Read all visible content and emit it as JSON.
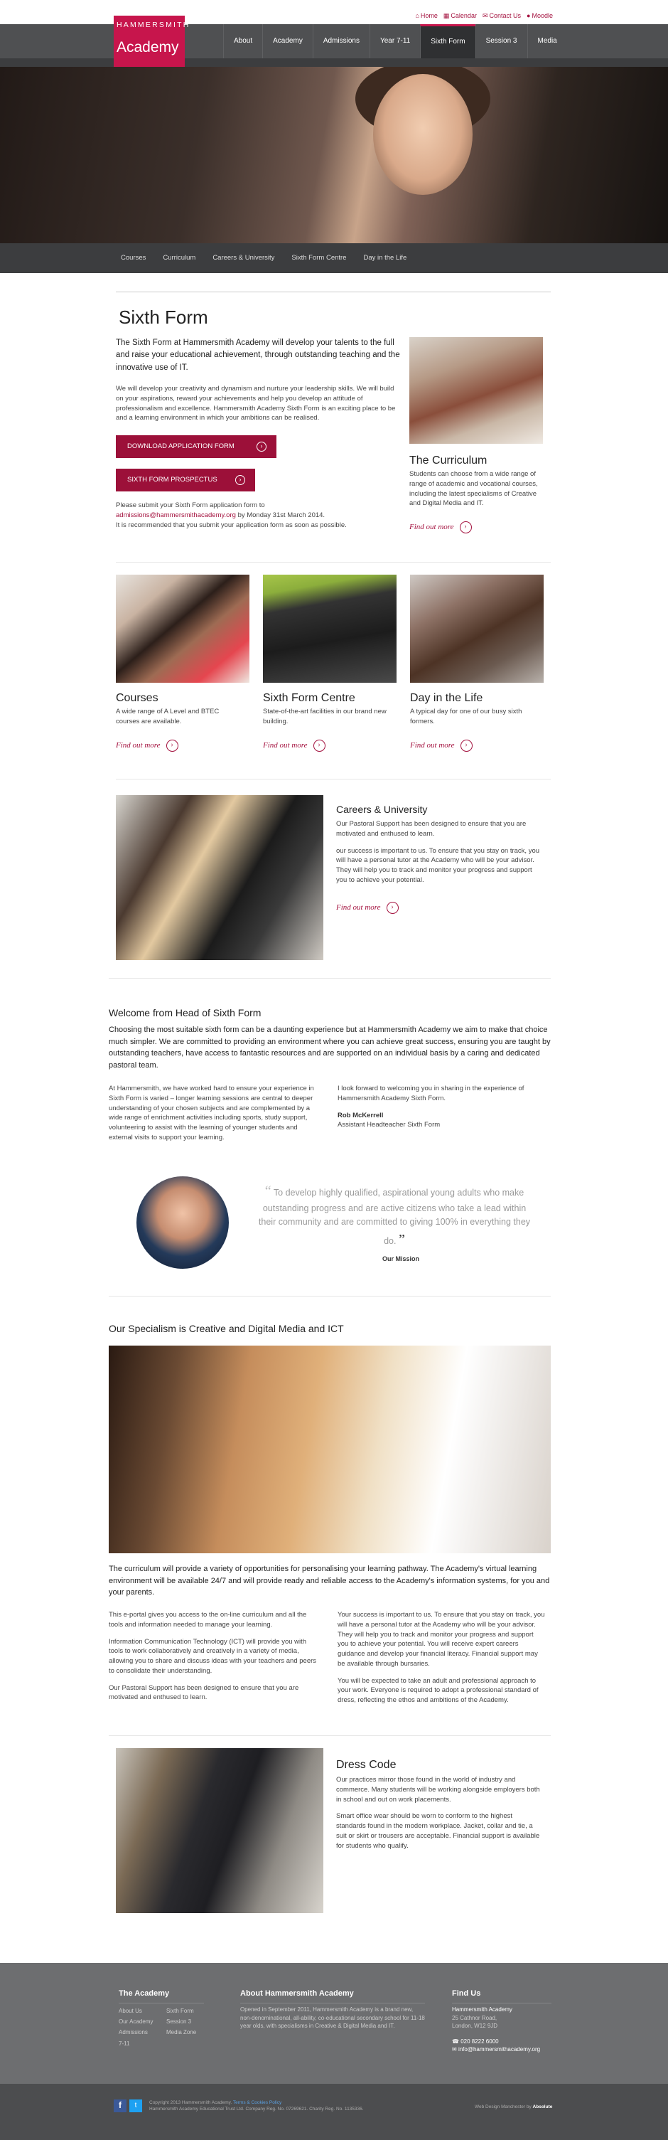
{
  "util_links": [
    {
      "icon": "home-icon",
      "label": "Home"
    },
    {
      "icon": "calendar-icon",
      "label": "Calendar"
    },
    {
      "icon": "mail-icon",
      "label": "Contact Us"
    },
    {
      "icon": "moodle-icon",
      "label": "Moodle"
    }
  ],
  "logo": {
    "line1": "HAMMERSMITH",
    "line2": "Academy"
  },
  "nav": [
    "About",
    "Academy",
    "Admissions",
    "Year 7-11",
    "Sixth Form",
    "Session 3",
    "Media"
  ],
  "subnav": [
    "Courses",
    "Curriculum",
    "Careers & University",
    "Sixth Form Centre",
    "Day in the Life"
  ],
  "intro": {
    "title": "Sixth Form",
    "lead": "The Sixth Form at Hammersmith Academy will develop your talents to the full and raise your educational achievement, through outstanding teaching and the innovative use of IT.",
    "body": "We will develop your creativity and dynamism and nurture your leadership skills. We will build on your aspirations, reward your achievements and help you develop an attitude of professionalism and excellence. Hammersmith Academy Sixth Form is an exciting place to be and a learning environment in which your ambitions can be realised.",
    "btn1": "DOWNLOAD APPLICATION FORM",
    "btn2": "SIXTH FORM PROSPECTUS",
    "submit1": "Please submit your Sixth Form application form to",
    "email": "admissions@hammersmithacademy.org",
    "submit2": "by Monday 31st March 2014.",
    "submit3": "It is recommended that you submit your application form as soon as possible."
  },
  "curriculum": {
    "title": "The Curriculum",
    "text": "Students can choose from a wide range of range of academic and vocational courses, including the latest specialisms of Creative and Digital Media and IT.",
    "link": "Find out more"
  },
  "cards": [
    {
      "title": "Courses",
      "text": "A wide range of A Level and BTEC courses are available.",
      "link": "Find out more"
    },
    {
      "title": "Sixth Form Centre",
      "text": "State-of-the-art facilities in our brand new building.",
      "link": "Find out more"
    },
    {
      "title": "Day in the Life",
      "text": "A typical day for one of our busy sixth formers.",
      "link": "Find out more"
    }
  ],
  "careers": {
    "title": "Careers & University",
    "p1": "Our Pastoral Support has been designed to ensure that you are motivated and enthused to learn.",
    "p2": "our success is important to us. To ensure that you stay on track, you will have a personal tutor at the Academy who will be your advisor. They will help you to track and monitor your progress and support you to achieve your potential.",
    "link": "Find out more"
  },
  "welcome": {
    "title": "Welcome from Head of Sixth Form",
    "lead": "Choosing the most suitable sixth form can be a daunting experience but at Hammersmith Academy we aim to make that choice much simpler. We are committed to providing an environment where you can achieve great success, ensuring you are taught by outstanding teachers, have access to fantastic resources and are supported on an individual basis by a caring and dedicated pastoral team.",
    "left": "At Hammersmith, we have worked hard to ensure your experience in Sixth Form is varied – longer learning sessions are central to deeper understanding of your chosen subjects and are complemented by a wide range of enrichment activities including sports, study support, volunteering to assist with the learning of younger students and external visits to support your learning.",
    "right": "I look forward to welcoming you in sharing in the experience of Hammersmith Academy Sixth Form.",
    "name": "Rob McKerrell",
    "role": "Assistant Headteacher Sixth Form"
  },
  "quote": {
    "text": "To develop highly qualified, aspirational young adults who make outstanding progress and are active citizens who take a lead within their community and are committed to giving 100% in everything they do.",
    "caption": "Our Mission"
  },
  "specialism": {
    "title": "Our Specialism is Creative and Digital Media and ICT",
    "lead": "The curriculum will provide a variety of opportunities for personalising your learning pathway. The Academy's virtual learning environment will be available 24/7 and will provide ready and reliable access to the Academy's information systems, for you and your parents.",
    "l1": "This e-portal gives you access to the on-line curriculum and all the tools and information needed to manage your learning.",
    "l2": "Information Communication Technology (ICT) will provide you with tools to work collaboratively and creatively in a variety of media, allowing you to share and discuss ideas with your teachers and peers to consolidate their understanding.",
    "l3": "Our Pastoral Support has been designed to ensure that you are motivated and enthused to learn.",
    "r1": "Your success is important to us. To ensure that you stay on track, you will have a personal tutor at the Academy who will be your advisor. They will help you to track and monitor your progress and support you to achieve your potential. You will receive expert careers guidance and develop your financial literacy. Financial support may be available through bursaries.",
    "r2": "You will be expected to take an adult and professional approach to your work. Everyone is required to adopt a professional standard of dress, reflecting the ethos and ambitions of the Academy."
  },
  "dress": {
    "title": "Dress Code",
    "p1": "Our practices mirror those found in the world of industry and commerce. Many students will be working alongside employers both in school and out on work placements.",
    "p2": "Smart office wear should be worn to conform to the highest standards found in the modern workplace. Jacket, collar and tie, a suit or skirt or trousers are acceptable.  Financial support is available for students who qualify."
  },
  "footer": {
    "col1_title": "The Academy",
    "col1a": [
      "About Us",
      "Our Academy",
      "Admissions",
      "7-11"
    ],
    "col1b": [
      "Sixth Form",
      "Session 3",
      "Media Zone"
    ],
    "col2_title": "About Hammersmith Academy",
    "col2_text": "Opened in September 2011, Hammersmith Academy is a brand new, non-denominational, all-ability, co-educational secondary school for 11-18 year olds, with specialisms in Creative & Digital Media and IT.",
    "col3_title": "Find Us",
    "address": [
      "Hammersmith Academy",
      "25 Cathnor Road,",
      "London, W12 9JD"
    ],
    "phone": "020 8222 6000",
    "email": "info@hammersmithacademy.org",
    "copyright1": "Copyright 2013 Hammersmith Academy.",
    "privacy": "Terms & Cookies Policy",
    "copyright2": "Hammersmith Academy Educational Trust Ltd. Company Reg. No. 07269621. Charity Reg. No. 1135336.",
    "credit": "Web Design Manchester by",
    "credit_brand": "Absolute"
  }
}
